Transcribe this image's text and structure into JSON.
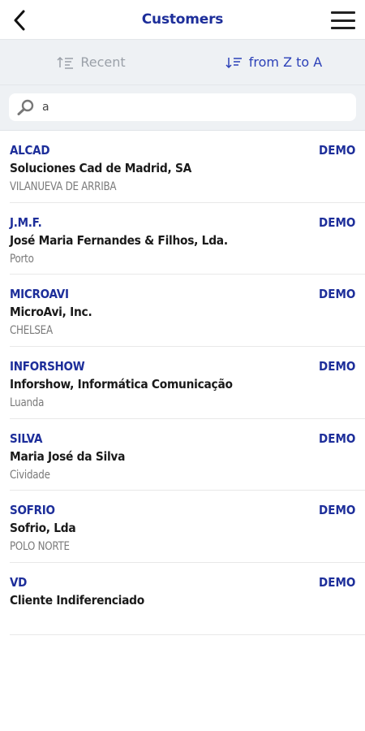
{
  "header": {
    "title": "Customers"
  },
  "sort": {
    "recent_label": "Recent",
    "ztoa_label": "from Z to A"
  },
  "search": {
    "value": "a"
  },
  "colors": {
    "accent": "#1d2e9a",
    "sort_active": "#2c41b8",
    "sort_inactive": "#9aa0a8",
    "toolbar_bg": "#eef1f4"
  },
  "customers": [
    {
      "code": "ALCAD",
      "name": "Soluciones Cad de Madrid, SA",
      "city": "VILANUEVA DE ARRIBA",
      "badge": "DEMO"
    },
    {
      "code": "J.M.F.",
      "name": "José Maria Fernandes & Filhos, Lda.",
      "city": "Porto",
      "badge": "DEMO"
    },
    {
      "code": "MICROAVI",
      "name": "MicroAvi, Inc.",
      "city": "CHELSEA",
      "badge": "DEMO"
    },
    {
      "code": "INFORSHOW",
      "name": "Inforshow, Informática Comunicação",
      "city": "Luanda",
      "badge": "DEMO"
    },
    {
      "code": "SILVA",
      "name": "Maria José da Silva",
      "city": "Cividade",
      "badge": "DEMO"
    },
    {
      "code": "SOFRIO",
      "name": "Sofrio, Lda",
      "city": "POLO NORTE",
      "badge": "DEMO"
    },
    {
      "code": "VD",
      "name": "Cliente Indiferenciado",
      "city": "",
      "badge": "DEMO"
    }
  ]
}
